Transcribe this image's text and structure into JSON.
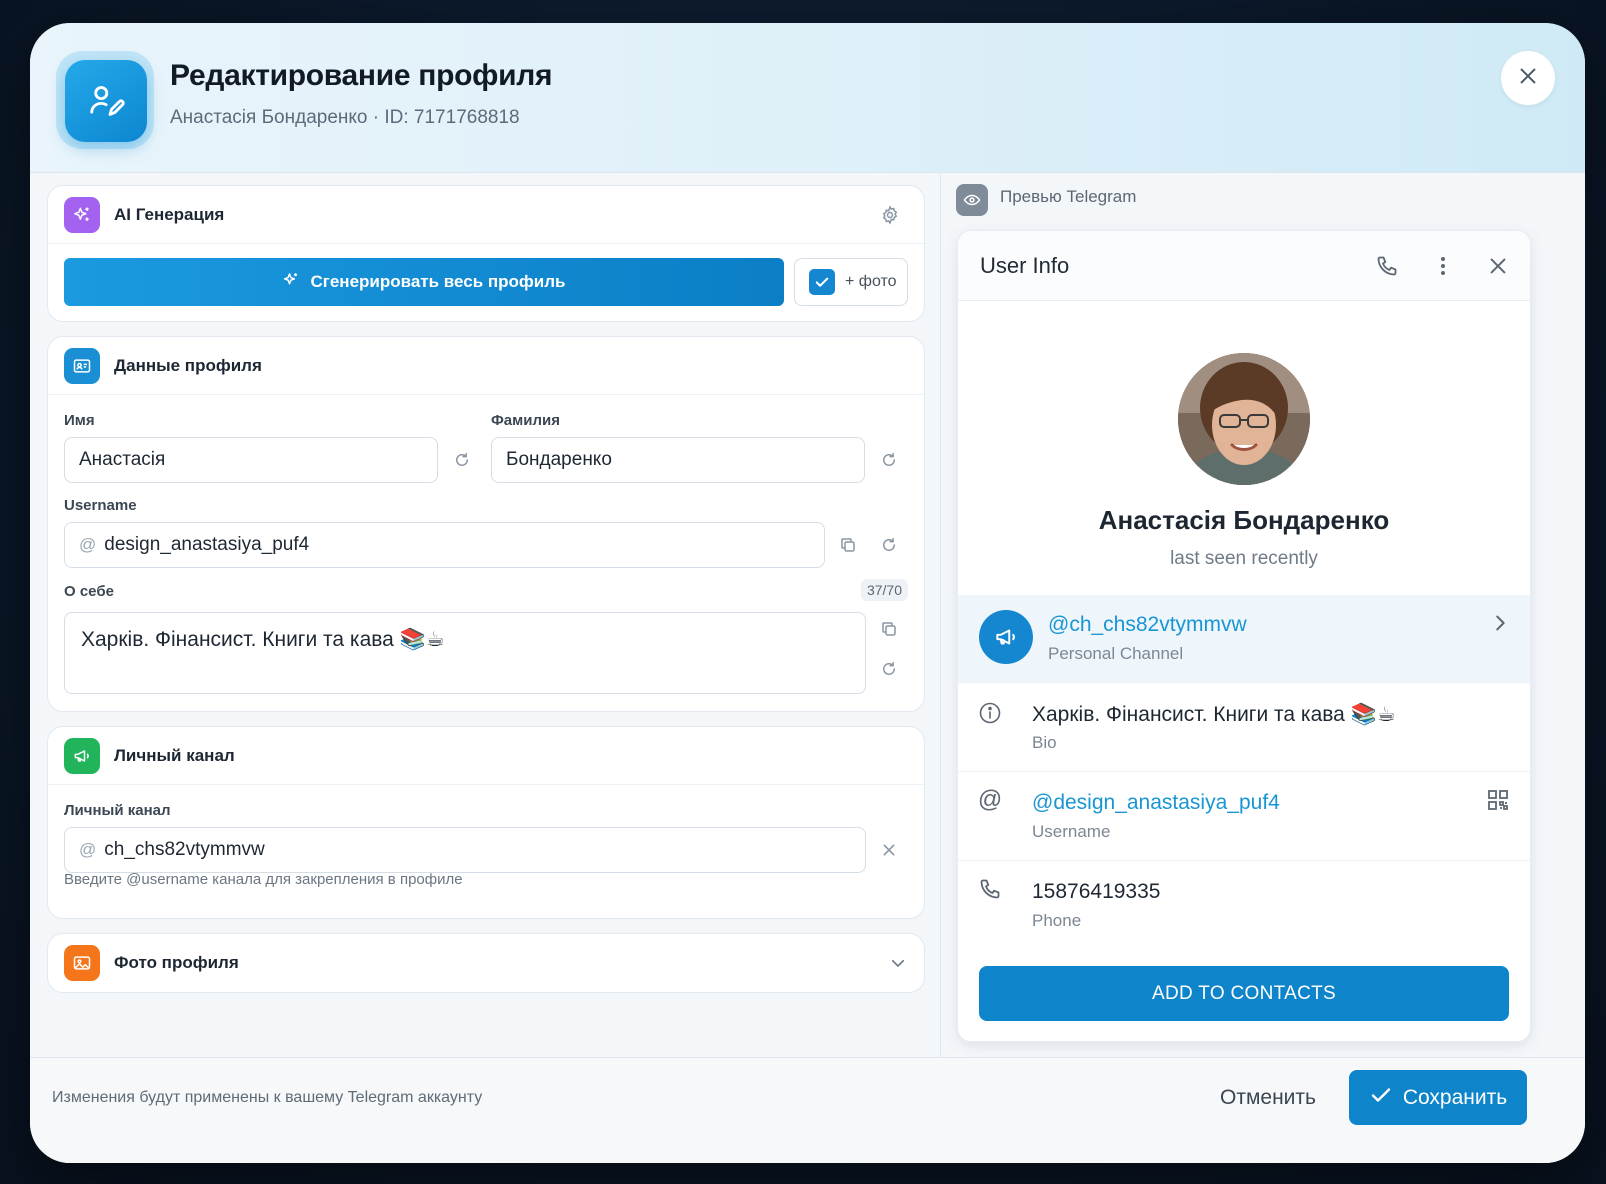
{
  "header": {
    "title": "Редактирование профиля",
    "subtitle": "Анастасія Бондаренко · ID: 7171768818"
  },
  "ai_card": {
    "title": "AI Генерация",
    "generate_label": "Сгенерировать весь профиль",
    "photo_toggle_label": "+ фото",
    "photo_toggle_checked": true
  },
  "profile_card": {
    "title": "Данные профиля",
    "first_name_label": "Имя",
    "first_name_value": "Анастасія",
    "last_name_label": "Фамилия",
    "last_name_value": "Бондаренко",
    "username_label": "Username",
    "username_prefix": "@",
    "username_value": "design_anastasiya_puf4",
    "bio_label": "О себе",
    "bio_counter": "37/70",
    "bio_value": "Харків. Фінансист. Книги та кава 📚☕"
  },
  "channel_card": {
    "title": "Личный канал",
    "channel_label": "Личный канал",
    "channel_prefix": "@",
    "channel_value": "ch_chs82vtymmvw",
    "hint": "Введите @username канала для закрепления в профиле"
  },
  "photo_card": {
    "title": "Фото профиля"
  },
  "preview": {
    "label": "Превью Telegram",
    "window_title": "User Info",
    "name": "Анастасія Бондаренко",
    "status": "last seen recently",
    "channel": "@ch_chs82vtymmvw",
    "channel_sub": "Personal Channel",
    "bio": "Харків. Фінансист. Книги та кава 📚☕",
    "bio_sub": "Bio",
    "username": "@design_anastasiya_puf4",
    "username_sub": "Username",
    "phone": "15876419335",
    "phone_sub": "Phone",
    "add_button": "ADD TO CONTACTS"
  },
  "footer": {
    "note": "Изменения будут применены к вашему Telegram аккаунту",
    "cancel_label": "Отменить",
    "save_label": "Сохранить"
  },
  "colors": {
    "accent": "#0e84cb",
    "ai_icon": "#a362f0",
    "profile_icon": "#1a8fd4",
    "channel_icon": "#22b45a",
    "photo_icon": "#f5761a"
  }
}
